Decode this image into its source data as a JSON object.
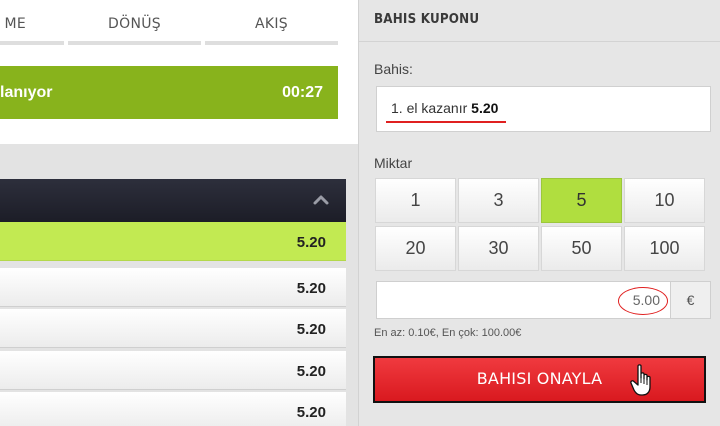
{
  "tabs": [
    {
      "label": "ME"
    },
    {
      "label": "DÖNÜŞ"
    },
    {
      "label": "AKIŞ"
    }
  ],
  "status": {
    "text": "lanıyor",
    "time": "00:27",
    "color": "#88b31c"
  },
  "odds_list": {
    "header_icon": "chevron-up-icon",
    "rows": [
      {
        "odd": "5.20",
        "active": true
      },
      {
        "odd": "5.20",
        "active": false
      },
      {
        "odd": "5.20",
        "active": false
      },
      {
        "odd": "5.20",
        "active": false
      },
      {
        "odd": "5.20",
        "active": false
      }
    ]
  },
  "coupon": {
    "title": "BAHIS KUPONU",
    "bet_label": "Bahis:",
    "selection_text": "1. el kazanır",
    "selection_odd": "5.20",
    "amount_label": "Miktar",
    "amounts": [
      "1",
      "3",
      "5",
      "10",
      "20",
      "30",
      "50",
      "100"
    ],
    "selected_amount": "5",
    "stake_value": "5.00",
    "currency": "€",
    "limits": "En az: 0.10€, En çok: 100.00€",
    "confirm_label": "BAHISI ONAYLA",
    "accent_red": "#e02020",
    "accent_green": "#b0de3f"
  }
}
